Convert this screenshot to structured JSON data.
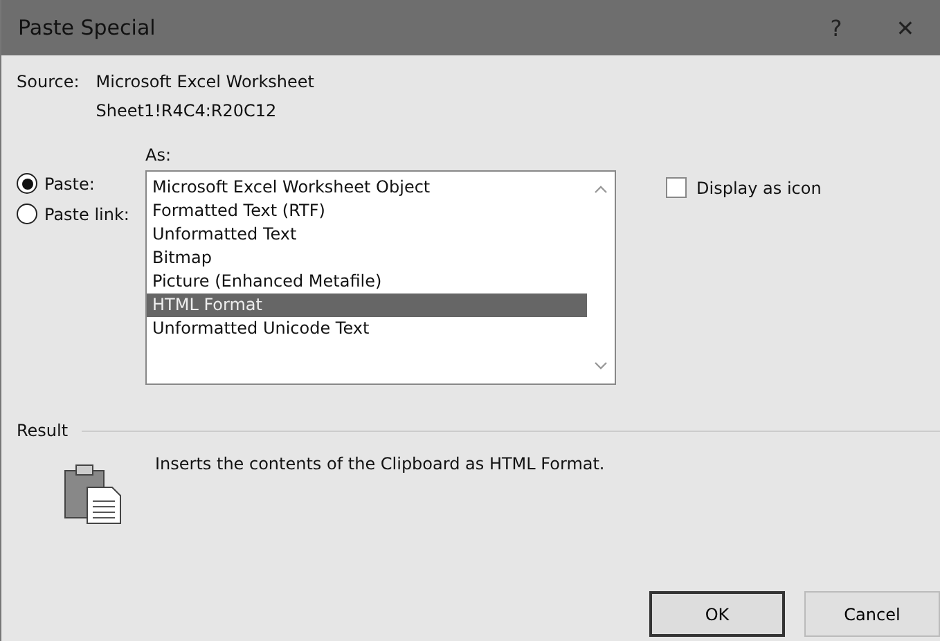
{
  "window": {
    "title": "Paste Special",
    "controls": [
      "?",
      "✕"
    ]
  },
  "source": {
    "label": "Source:",
    "lines": [
      "Microsoft Excel Worksheet",
      "Sheet1!R4C4:R20C12"
    ]
  },
  "as_label": "As:",
  "paste_options": [
    {
      "label": "Paste:",
      "selected": true
    },
    {
      "label": "Paste link:",
      "selected": false
    }
  ],
  "formats": [
    {
      "label": "Microsoft Excel Worksheet Object",
      "selected": false
    },
    {
      "label": "Formatted Text (RTF)",
      "selected": false
    },
    {
      "label": "Unformatted Text",
      "selected": false
    },
    {
      "label": "Bitmap",
      "selected": false
    },
    {
      "label": "Picture (Enhanced Metafile)",
      "selected": false
    },
    {
      "label": "HTML Format",
      "selected": true
    },
    {
      "label": "Unformatted Unicode Text",
      "selected": false
    }
  ],
  "display_as_icon": {
    "label": "Display as icon",
    "checked": false
  },
  "result": {
    "label": "Result",
    "text": "Inserts the contents of the Clipboard as HTML Format."
  },
  "buttons": [
    {
      "label": "OK",
      "default": true
    },
    {
      "label": "Cancel",
      "default": false
    }
  ]
}
